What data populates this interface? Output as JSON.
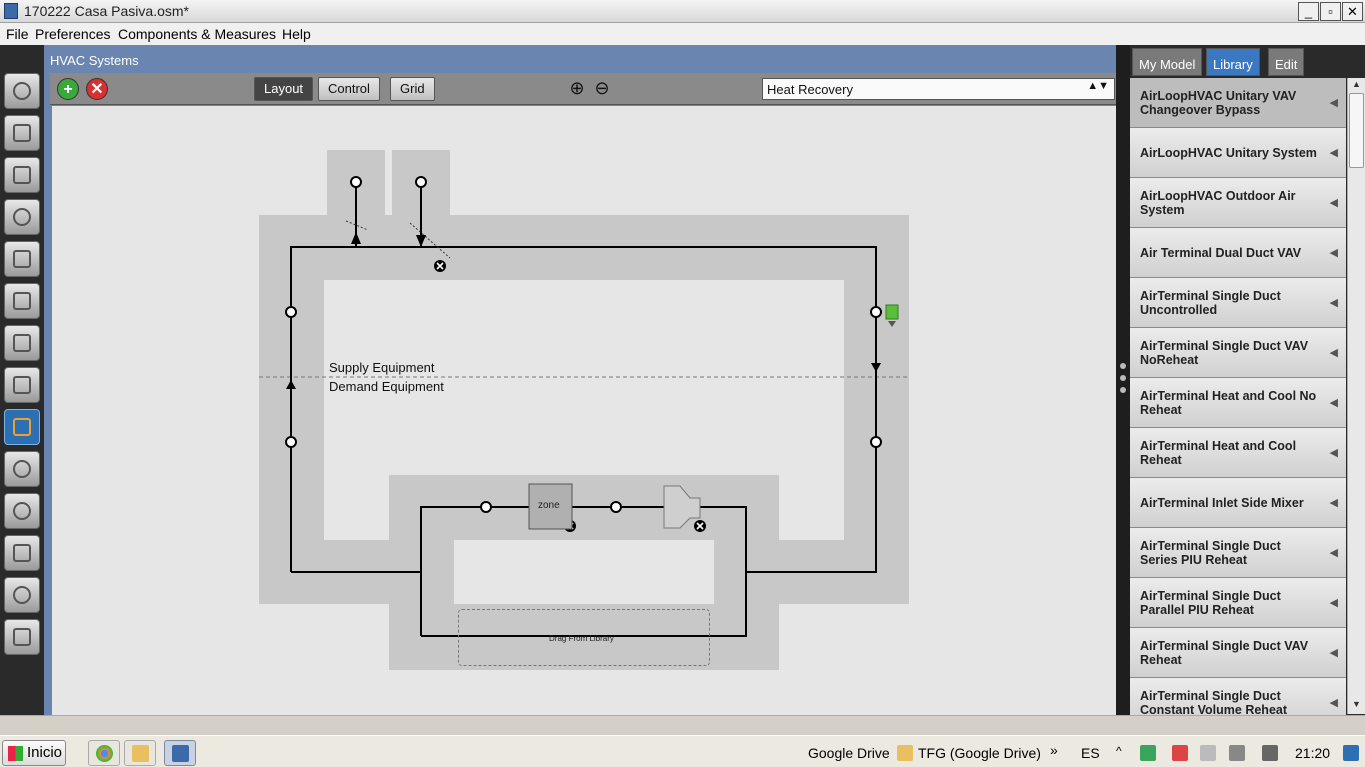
{
  "window": {
    "title": "170222 Casa Pasiva.osm*",
    "minimize": "_",
    "maximize": "▫",
    "close": "✕"
  },
  "menu": [
    "File",
    "Preferences",
    "Components & Measures",
    "Help"
  ],
  "main": {
    "header": "HVAC Systems",
    "toolbar": {
      "add": "+",
      "remove": "✕",
      "tabs": [
        "Layout",
        "Control",
        "Grid"
      ],
      "active_tab": "Layout",
      "zoom_in": "⊕",
      "zoom_out": "⊖",
      "system_select": "Heat Recovery"
    },
    "diagram": {
      "supply_label": "Supply Equipment",
      "demand_label": "Demand Equipment",
      "zone_label": "zone",
      "drop_zone_label": "Drag From Library"
    }
  },
  "right_panel": {
    "tabs": [
      "My Model",
      "Library",
      "Edit"
    ],
    "active_tab": "Library",
    "library_items": [
      "AirLoopHVAC Unitary VAV Changeover Bypass",
      "AirLoopHVAC Unitary System",
      "AirLoopHVAC Outdoor Air System",
      "Air Terminal Dual Duct VAV",
      "AirTerminal Single Duct Uncontrolled",
      "AirTerminal Single Duct VAV NoReheat",
      "AirTerminal Heat and Cool No Reheat",
      "AirTerminal Heat and Cool Reheat",
      "AirTerminal Inlet Side Mixer",
      "AirTerminal Single Duct Series PIU Reheat",
      "AirTerminal Single Duct Parallel PIU Reheat",
      "AirTerminal Single Duct VAV Reheat",
      "AirTerminal Single Duct Constant Volume Reheat"
    ]
  },
  "taskbar": {
    "start": "Inicio",
    "tray": [
      "Google Drive",
      "TFG (Google Drive)"
    ],
    "chevron": "»",
    "language": "ES",
    "time": "21:20"
  },
  "colors": {
    "accent": "#3a78c2",
    "duct": "#000000",
    "block": "#c8c8c8",
    "canvas": "#e6e6e6"
  }
}
